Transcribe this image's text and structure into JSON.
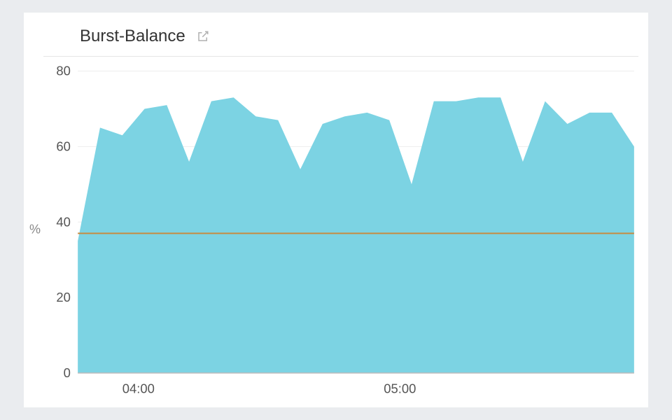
{
  "header": {
    "title": "Burst-Balance"
  },
  "chart_data": {
    "type": "area",
    "title": "Burst-Balance",
    "ylabel": "%",
    "xlabel": "",
    "ylim": [
      0,
      80
    ],
    "y_ticks": [
      0,
      20,
      40,
      60,
      80
    ],
    "x_ticks": [
      "04:00",
      "05:00"
    ],
    "threshold": 37,
    "series": [
      {
        "name": "Burst-Balance",
        "values": [
          35,
          65,
          63,
          70,
          71,
          56,
          72,
          73,
          68,
          67,
          54,
          66,
          68,
          69,
          67,
          50,
          72,
          72,
          73,
          73,
          56,
          72,
          66,
          69,
          69,
          60
        ]
      }
    ]
  }
}
